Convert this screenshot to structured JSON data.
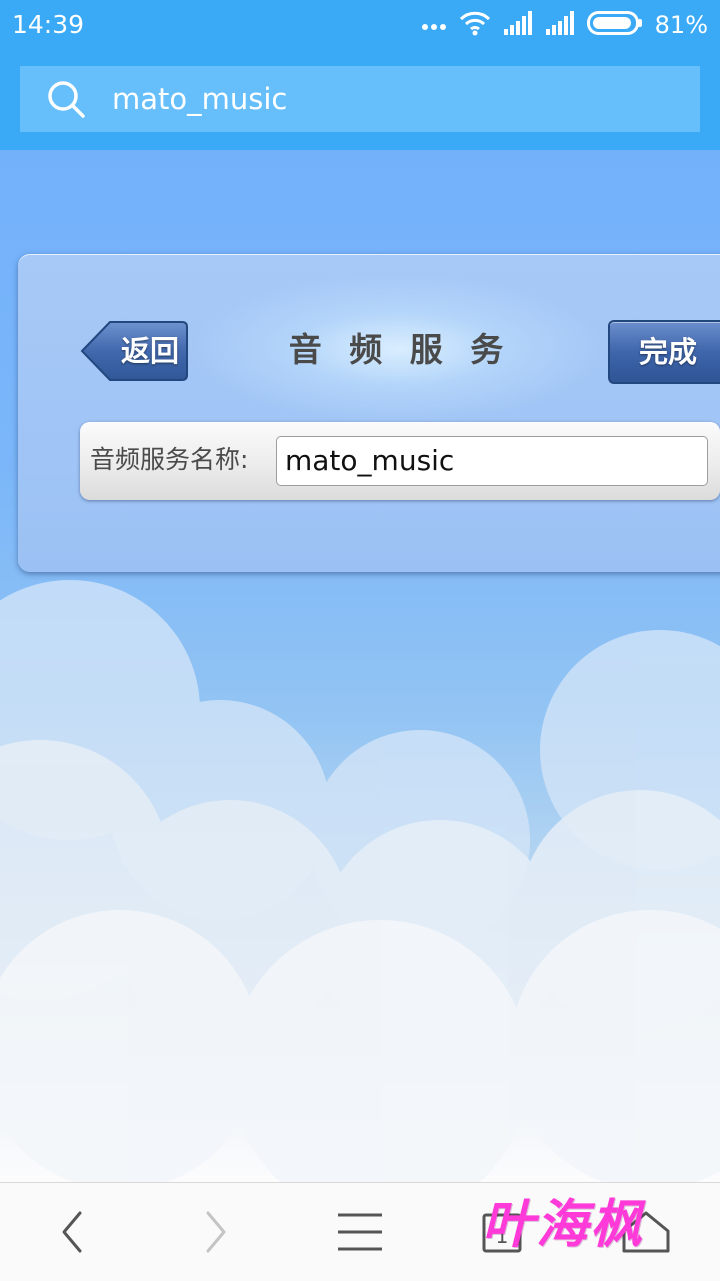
{
  "status_bar": {
    "time": "14:39",
    "battery_percent": "81%",
    "icons": [
      "more-dots-icon",
      "wifi-icon",
      "signal-icon",
      "signal-icon",
      "battery-icon"
    ]
  },
  "search": {
    "query": "mato_music",
    "icon": "search-icon"
  },
  "page": {
    "title": "音 频 服 务",
    "back_label": "返回",
    "done_label": "完成",
    "field_label": "音频服务名称:",
    "field_value": "mato_music"
  },
  "bottom_nav": {
    "items": [
      "back-icon",
      "forward-icon",
      "menu-icon",
      "tabs-icon",
      "home-icon"
    ],
    "tab_count": "1"
  },
  "watermark": "叶海枫",
  "colors": {
    "status_bar": "#3aa9f6",
    "search_bar": "#66bffa",
    "done_button": "#3f65ab",
    "watermark": "#ff3ad8"
  }
}
